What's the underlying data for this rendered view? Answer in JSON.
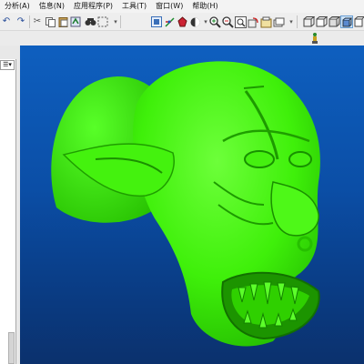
{
  "menu": [
    "分析(A)",
    "信息(N)",
    "应用程序(P)",
    "工具(T)",
    "窗口(W)",
    "帮助(H)"
  ],
  "toolbar": {
    "icons": [
      "undo-icon",
      "redo-icon",
      "cut-icon",
      "copy-icon",
      "paste-icon",
      "regenerate-icon",
      "find-icon",
      "select-box-icon",
      "repaint-icon",
      "spin-center-icon",
      "orient-icon",
      "shading-icon",
      "zoom-in-icon",
      "zoom-out-icon",
      "refit-icon",
      "reorient-icon",
      "saved-views-icon",
      "layers-icon",
      "display-style-icon",
      "datum-display-icon"
    ]
  },
  "model": {
    "description": "green 3D model of a creature head (goblin/ogre) with pointed ear, open fanged mouth and nose ring",
    "color": "#33ee00"
  },
  "colors": {
    "viewport_top": "#0e5fbf",
    "viewport_bottom": "#0b316d",
    "model_fill": "#33ee00"
  }
}
